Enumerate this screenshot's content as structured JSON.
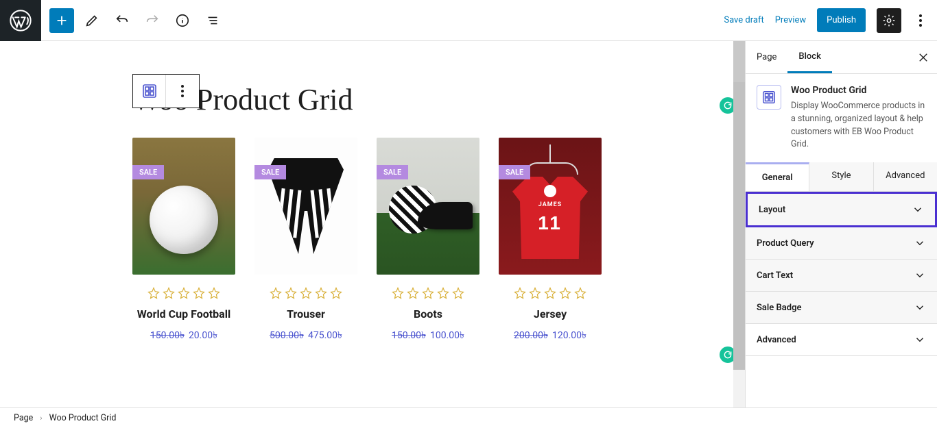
{
  "topbar": {
    "save_draft": "Save draft",
    "preview": "Preview",
    "publish": "Publish"
  },
  "page": {
    "title": "Woo Product Grid"
  },
  "sale_label": "SALE",
  "products": [
    {
      "name": "World Cup Football",
      "old_price": "150.00৳",
      "new_price": "20.00৳"
    },
    {
      "name": "Trouser",
      "old_price": "500.00৳",
      "new_price": "475.00৳"
    },
    {
      "name": "Boots",
      "old_price": "150.00৳",
      "new_price": "100.00৳"
    },
    {
      "name": "Jersey",
      "old_price": "200.00৳",
      "new_price": "120.00৳",
      "jersey_name": "JAMES",
      "jersey_number": "11"
    }
  ],
  "sidebar": {
    "tabs": {
      "page": "Page",
      "block": "Block"
    },
    "block_title": "Woo Product Grid",
    "block_description": "Display WooCommerce products in a stunning, organized layout & help customers with EB Woo Product Grid.",
    "panel_tabs": {
      "general": "General",
      "style": "Style",
      "advanced": "Advanced"
    },
    "sections": {
      "layout": "Layout",
      "product_query": "Product Query",
      "cart_text": "Cart Text",
      "sale_badge": "Sale Badge",
      "advanced": "Advanced"
    }
  },
  "breadcrumb": {
    "page": "Page",
    "block": "Woo Product Grid"
  }
}
